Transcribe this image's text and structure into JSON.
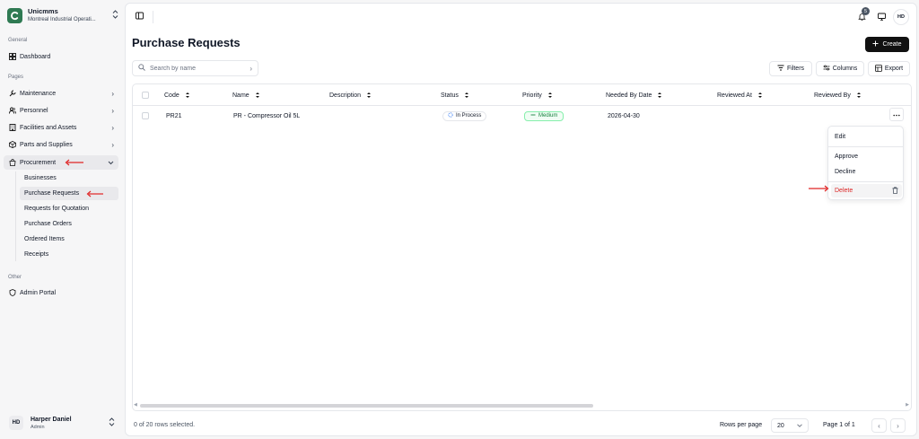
{
  "org": {
    "name": "Unicmms",
    "subtitle": "Montreal Industrial Operati..."
  },
  "sidebar": {
    "sections": {
      "general": "General",
      "pages": "Pages",
      "other": "Other"
    },
    "dashboard": "Dashboard",
    "items": [
      {
        "label": "Maintenance"
      },
      {
        "label": "Personnel"
      },
      {
        "label": "Facilities and Assets"
      },
      {
        "label": "Parts and Supplies"
      },
      {
        "label": "Procurement"
      }
    ],
    "procurement_sub": [
      {
        "label": "Businesses"
      },
      {
        "label": "Purchase Requests"
      },
      {
        "label": "Requests for Quotation"
      },
      {
        "label": "Purchase Orders"
      },
      {
        "label": "Ordered Items"
      },
      {
        "label": "Receipts"
      }
    ],
    "admin_portal": "Admin Portal"
  },
  "user": {
    "name": "Harper Daniel",
    "role": "Admin",
    "initials": "HD"
  },
  "header": {
    "notification_count": "5",
    "avatar_initials": "HD"
  },
  "page": {
    "title": "Purchase Requests",
    "create_label": "Create"
  },
  "toolbar": {
    "search_placeholder": "Search by name",
    "filters_label": "Filters",
    "columns_label": "Columns",
    "export_label": "Export"
  },
  "table": {
    "columns": [
      "Code",
      "Name",
      "Description",
      "Status",
      "Priority",
      "Needed By Date",
      "Reviewed At",
      "Reviewed By"
    ],
    "rows": [
      {
        "code": "PR21",
        "name": "PR - Compressor Oil 5L",
        "description": "",
        "status": "In Process",
        "priority": "Medium",
        "needed_by": "2026-04-30",
        "reviewed_at": "",
        "reviewed_by": ""
      }
    ]
  },
  "row_menu": {
    "edit": "Edit",
    "approve": "Approve",
    "decline": "Decline",
    "delete": "Delete"
  },
  "footer": {
    "selected_text": "0 of 20 rows selected.",
    "rows_per_page_label": "Rows per page",
    "rows_per_page_value": "20",
    "page_text": "Page 1 of 1"
  },
  "colors": {
    "brand": "#2f7a53",
    "annotation": "#e02424",
    "danger": "#dc2626",
    "priority": "#15803d"
  }
}
